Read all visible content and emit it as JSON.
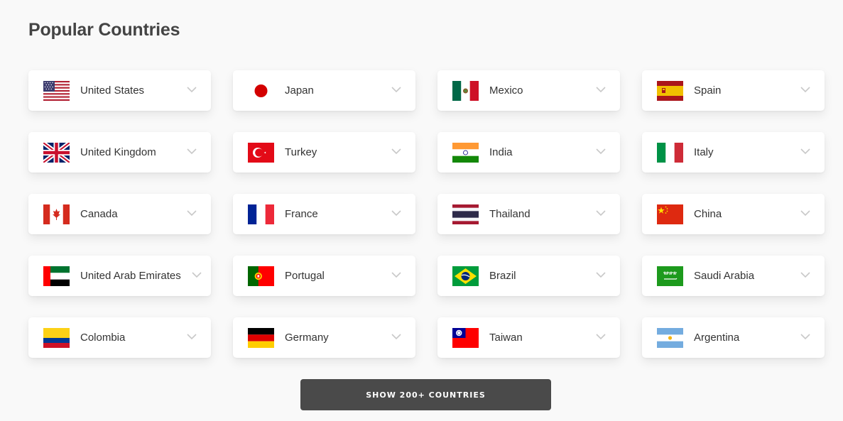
{
  "section": {
    "title": "Popular Countries"
  },
  "countries": [
    {
      "name": "United States",
      "flag": "us-flag-icon"
    },
    {
      "name": "Japan",
      "flag": "jp-flag-icon"
    },
    {
      "name": "Mexico",
      "flag": "mx-flag-icon"
    },
    {
      "name": "Spain",
      "flag": "es-flag-icon"
    },
    {
      "name": "United Kingdom",
      "flag": "gb-flag-icon"
    },
    {
      "name": "Turkey",
      "flag": "tr-flag-icon"
    },
    {
      "name": "India",
      "flag": "in-flag-icon"
    },
    {
      "name": "Italy",
      "flag": "it-flag-icon"
    },
    {
      "name": "Canada",
      "flag": "ca-flag-icon"
    },
    {
      "name": "France",
      "flag": "fr-flag-icon"
    },
    {
      "name": "Thailand",
      "flag": "th-flag-icon"
    },
    {
      "name": "China",
      "flag": "cn-flag-icon"
    },
    {
      "name": "United Arab Emirates",
      "flag": "ae-flag-icon"
    },
    {
      "name": "Portugal",
      "flag": "pt-flag-icon"
    },
    {
      "name": "Brazil",
      "flag": "br-flag-icon"
    },
    {
      "name": "Saudi Arabia",
      "flag": "sa-flag-icon"
    },
    {
      "name": "Colombia",
      "flag": "co-flag-icon"
    },
    {
      "name": "Germany",
      "flag": "de-flag-icon"
    },
    {
      "name": "Taiwan",
      "flag": "tw-flag-icon"
    },
    {
      "name": "Argentina",
      "flag": "ar-flag-icon"
    }
  ],
  "show_more": {
    "label": "SHOW 200+ COUNTRIES"
  },
  "colors": {
    "background": "#f9f9f9",
    "button": "#4a4a4a",
    "title": "#444444"
  }
}
